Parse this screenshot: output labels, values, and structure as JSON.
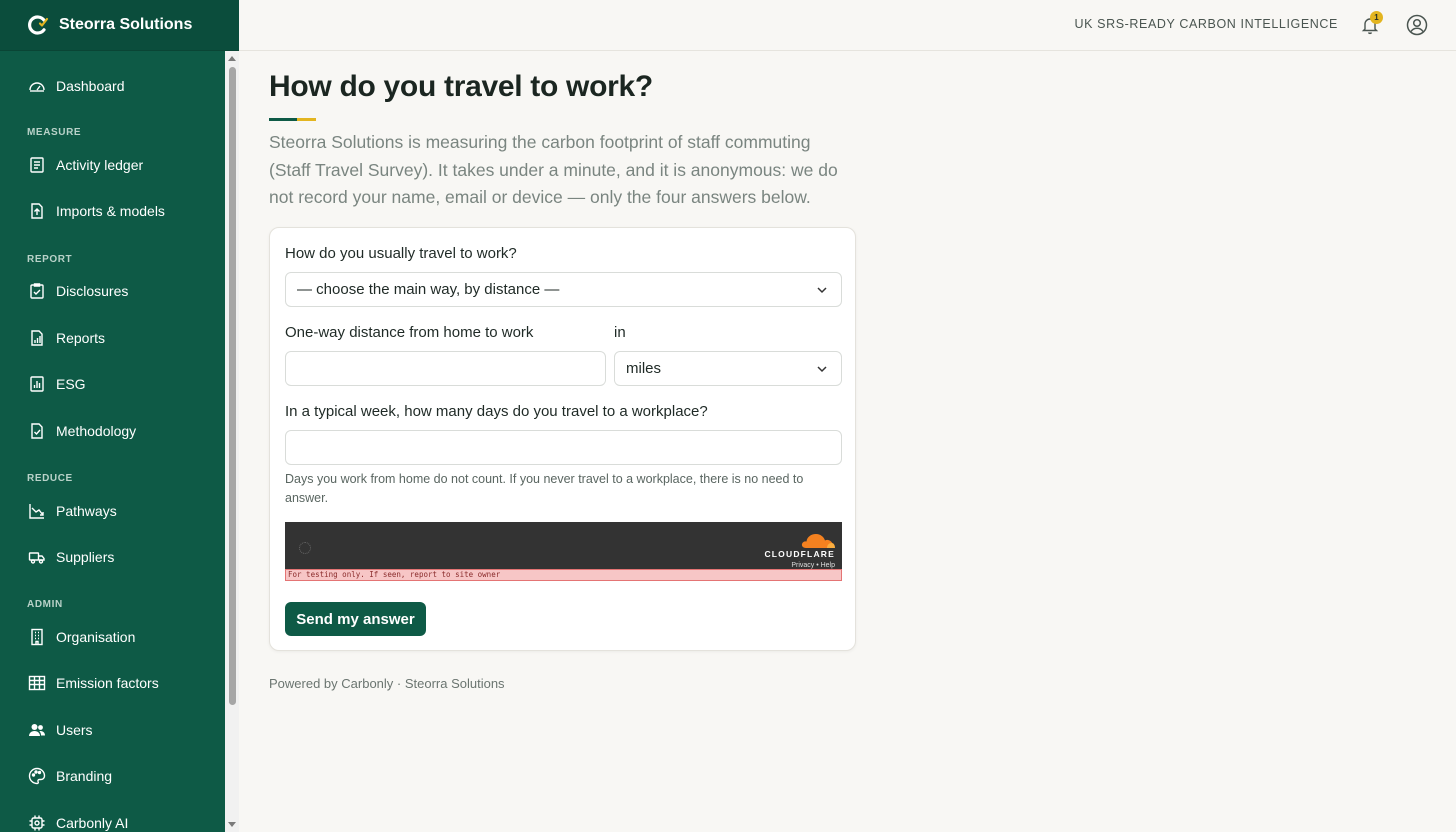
{
  "app": {
    "name": "Steorra Solutions"
  },
  "topbar": {
    "label": "UK SRS-READY CARBON INTELLIGENCE",
    "notification_count": "1"
  },
  "sidebar": {
    "dashboard": "Dashboard",
    "sections": {
      "measure": "MEASURE",
      "report": "REPORT",
      "reduce": "REDUCE",
      "admin": "ADMIN"
    },
    "items": {
      "activity_ledger": "Activity ledger",
      "imports_models": "Imports & models",
      "disclosures": "Disclosures",
      "reports": "Reports",
      "esg": "ESG",
      "methodology": "Methodology",
      "pathways": "Pathways",
      "suppliers": "Suppliers",
      "organisation": "Organisation",
      "emission_factors": "Emission factors",
      "users": "Users",
      "branding": "Branding",
      "carbonly_ai": "Carbonly AI"
    }
  },
  "page": {
    "title": "How do you travel to work?",
    "intro": "Steorra Solutions is measuring the carbon footprint of staff commuting (Staff Travel Survey). It takes under a minute, and it is anonymous: we do not record your name, email or device — only the four answers below."
  },
  "form": {
    "mode_label": "How do you usually travel to work?",
    "mode_value": "— choose the main way, by distance —",
    "distance_label": "One-way distance from home to work",
    "unit_label": "in",
    "distance_value": "",
    "unit_value": "miles",
    "days_label": "In a typical week, how many days do you travel to a workplace?",
    "days_value": "",
    "days_hint": "Days you work from home do not count. If you never travel to a workplace, there is no need to answer.",
    "captcha": {
      "brand": "CLOUDFLARE",
      "links": "Privacy • Help",
      "warning": "For testing only. If seen, report to site owner"
    },
    "submit_label": "Send my answer"
  },
  "footer": {
    "text": "Powered by Carbonly · Steorra Solutions"
  },
  "colors": {
    "sidebar": "#0e5a46",
    "accent": "#e3b520",
    "button": "#0e5a46"
  }
}
